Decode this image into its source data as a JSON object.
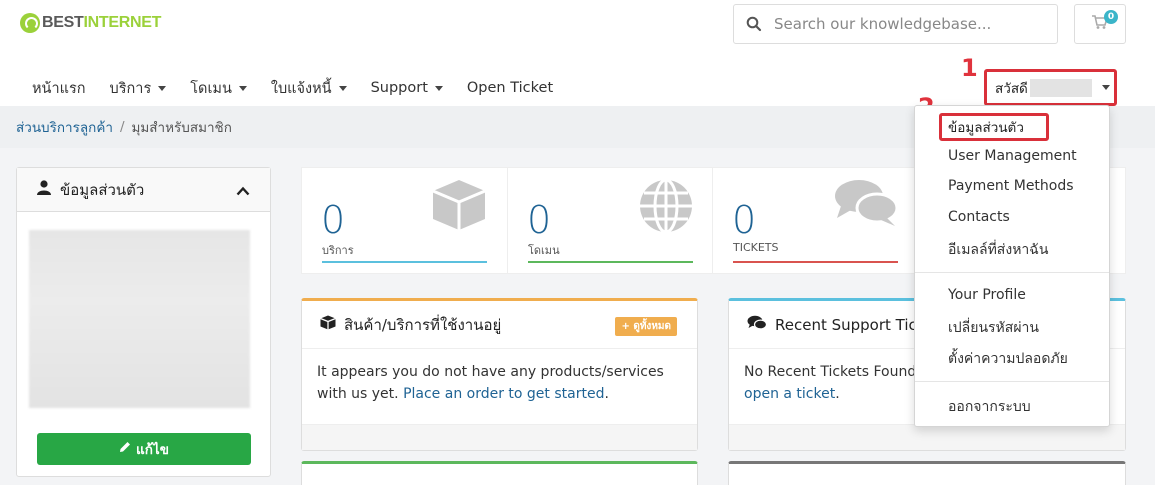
{
  "brand": {
    "name_part1": "BEST",
    "name_part2": "INTERNET"
  },
  "search": {
    "placeholder": "Search our knowledgebase..."
  },
  "cart": {
    "count": "0"
  },
  "nav": {
    "items": [
      {
        "label": "หน้าแรก"
      },
      {
        "label": "บริการ"
      },
      {
        "label": "โดเมน"
      },
      {
        "label": "ใบแจ้งหนี้"
      },
      {
        "label": "Support"
      },
      {
        "label": "Open Ticket"
      }
    ]
  },
  "account": {
    "greeting": "สวัสดี"
  },
  "annotations": {
    "step1": "1",
    "step2": "2"
  },
  "breadcrumb": {
    "home": "ส่วนบริการลูกค้า",
    "separator": "/",
    "current": "มุมสำหรับสมาชิก"
  },
  "profile_panel": {
    "title": "ข้อมูลส่วนตัว",
    "edit_label": "แก้ไข"
  },
  "stats": [
    {
      "value": "0",
      "label": "บริการ",
      "color": "#5bc0de"
    },
    {
      "value": "0",
      "label": "โดเมน",
      "color": "#5cb85c"
    },
    {
      "value": "0",
      "label": "TICKETS",
      "color": "#d9534f"
    }
  ],
  "products_panel": {
    "title": "สินค้า/บริการที่ใช้งานอยู่",
    "badge": "ดูทั้งหมด",
    "text": "It appears you do not have any products/services with us yet.",
    "link": "Place an order to get started",
    "tail": "."
  },
  "tickets_panel": {
    "title": "Recent Support Tic",
    "text": "No Recent Tickets Found.",
    "link": "open a ticket",
    "tail": "."
  },
  "dropdown": {
    "items": [
      {
        "label": "ข้อมูลส่วนตัว"
      },
      {
        "label": "User Management"
      },
      {
        "label": "Payment Methods"
      },
      {
        "label": "Contacts"
      },
      {
        "label": "อีเมลล์ที่ส่งหาฉัน"
      },
      {
        "label": "Your Profile"
      },
      {
        "label": "เปลี่ยนรหัสผ่าน"
      },
      {
        "label": "ตั้งค่าความปลอดภัย"
      },
      {
        "label": "ออกจากระบบ"
      }
    ]
  },
  "colors": {
    "accent": "#1f6394",
    "highlight": "#d9303a",
    "brand_green": "#9bd13a"
  }
}
